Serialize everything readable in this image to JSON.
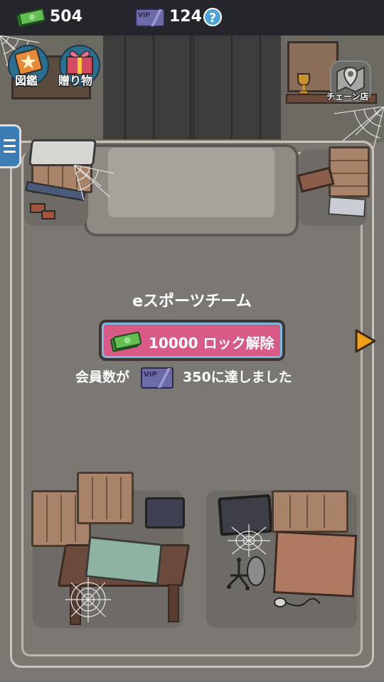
{
  "currency": {
    "cash": "504",
    "vip": "124",
    "help": "?"
  },
  "buttons": {
    "encyclopedia": "図鑑",
    "gifts": "贈り物",
    "chain_store": "チェーン店"
  },
  "room": {
    "title": "eスポーツチーム",
    "unlock_label": "10000 ロック解除",
    "req_prefix": "会員数が",
    "req_suffix": "350に達しました"
  },
  "colors": {
    "unlock_button": "#d75b86",
    "topbar": "#24262b",
    "menu_tab": "#3d7db5",
    "next_arrow": "#f2a019"
  }
}
